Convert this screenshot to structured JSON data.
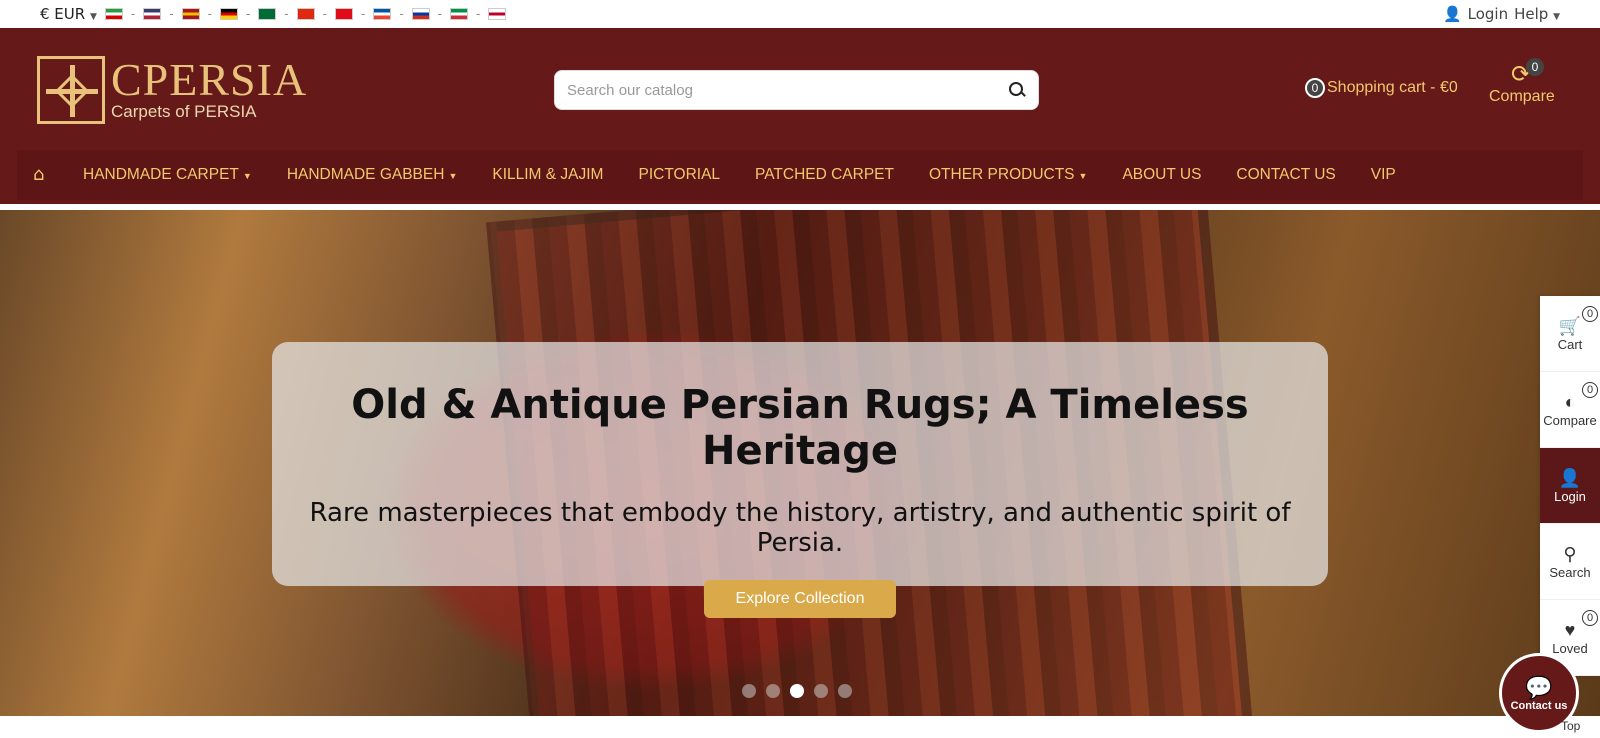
{
  "topbar": {
    "currency": "€ EUR",
    "flags": [
      {
        "name": "iran-flag",
        "colors": [
          "#239f40",
          "#ffffff",
          "#da0000"
        ]
      },
      {
        "name": "usa-flag",
        "colors": [
          "#3c3b6e",
          "#ffffff",
          "#b22234"
        ]
      },
      {
        "name": "spain-flag",
        "colors": [
          "#aa151b",
          "#f1bf00",
          "#aa151b"
        ]
      },
      {
        "name": "germany-flag",
        "colors": [
          "#000000",
          "#dd0000",
          "#ffce00"
        ]
      },
      {
        "name": "saudi-flag",
        "colors": [
          "#006c35",
          "#006c35",
          "#006c35"
        ]
      },
      {
        "name": "china-flag",
        "colors": [
          "#de2910",
          "#de2910",
          "#de2910"
        ]
      },
      {
        "name": "turkey-flag",
        "colors": [
          "#e30a17",
          "#e30a17",
          "#e30a17"
        ]
      },
      {
        "name": "france-flag",
        "colors": [
          "#0055a4",
          "#ffffff",
          "#ef4135"
        ]
      },
      {
        "name": "russia-flag",
        "colors": [
          "#ffffff",
          "#0039a6",
          "#d52b1e"
        ]
      },
      {
        "name": "italy-flag",
        "colors": [
          "#009246",
          "#ffffff",
          "#ce2b37"
        ]
      },
      {
        "name": "japan-flag",
        "colors": [
          "#ffffff",
          "#bc002d",
          "#ffffff"
        ]
      }
    ],
    "login": "Login",
    "help": "Help"
  },
  "header": {
    "logo_brand": "CPERSIA",
    "logo_sub": "Carpets of PERSIA",
    "search_placeholder": "Search our catalog",
    "cart_count": "0",
    "cart_label": "Shopping cart - €0",
    "compare_count": "0",
    "compare_label": "Compare"
  },
  "nav": {
    "items": [
      {
        "label": "HANDMADE CARPET",
        "dropdown": true
      },
      {
        "label": "HANDMADE GABBEH",
        "dropdown": true
      },
      {
        "label": "KILLIM & JAJIM",
        "dropdown": false
      },
      {
        "label": "PICTORIAL",
        "dropdown": false
      },
      {
        "label": "PATCHED CARPET",
        "dropdown": false
      },
      {
        "label": "OTHER PRODUCTS",
        "dropdown": true
      },
      {
        "label": "ABOUT US",
        "dropdown": false
      },
      {
        "label": "CONTACT US",
        "dropdown": false
      },
      {
        "label": "VIP",
        "dropdown": false
      }
    ]
  },
  "hero": {
    "title": "Old & Antique Persian Rugs; A Timeless Heritage",
    "subtitle": "Rare masterpieces that embody the history, artistry, and authentic spirit of Persia.",
    "button": "Explore Collection",
    "slide_count": 5,
    "active_slide": 3
  },
  "side_panel": {
    "cart": {
      "label": "Cart",
      "count": "0"
    },
    "compare": {
      "label": "Compare",
      "count": "0"
    },
    "login": {
      "label": "Login"
    },
    "search": {
      "label": "Search"
    },
    "loved": {
      "label": "Loved",
      "count": "0"
    }
  },
  "contact_bubble": "Contact us",
  "top_label": "Top",
  "colors": {
    "header_bg": "#651919",
    "accent_gold": "#f2c86e",
    "button_gold": "#d9a94a"
  }
}
